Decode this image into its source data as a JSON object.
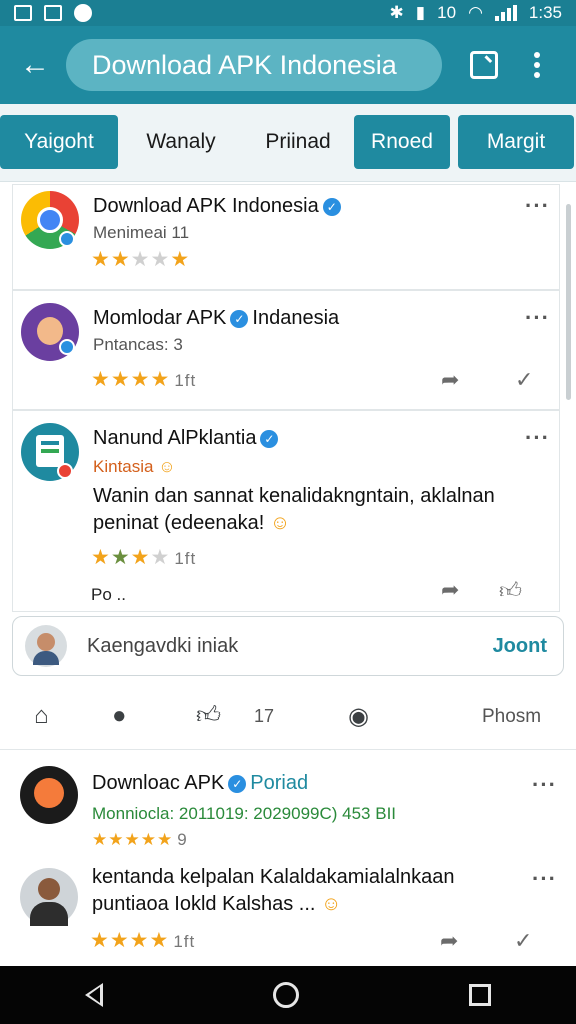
{
  "status": {
    "time": "1:35",
    "battery": "10"
  },
  "header": {
    "title": "Download APK Indonesia"
  },
  "tabs": [
    {
      "label": "Yaigoht",
      "filled": true
    },
    {
      "label": "Wanaly",
      "filled": false
    },
    {
      "label": "Priinad",
      "filled": false
    },
    {
      "label": "Rnoed",
      "filled": true
    },
    {
      "label": "Margit",
      "filled": true
    }
  ],
  "posts": [
    {
      "name": "Download APK Indonesia",
      "subtitle": "Menimeai 11",
      "stars": 5
    },
    {
      "name_a": "Momlodar APK",
      "name_b": "Indanesia",
      "subtitle": "Pntancas: 3",
      "rating_count": "1ft"
    },
    {
      "name": "Nanund AlPklantia",
      "subtitle": "Kintasia",
      "body_line1": "Wanin dan sannat kenalidakngntain, aklalnan",
      "body_line2": "peninat (edeenaka!",
      "rating_count": "1ft",
      "more_text": "Po .."
    }
  ],
  "comment": {
    "placeholder": "Kaengavdki iniak",
    "join": "Joont"
  },
  "toolbar": {
    "count": "17",
    "label": "Phosm"
  },
  "feed": [
    {
      "name_a": "Downloac APK",
      "name_b": "Poriad",
      "meta": "Monniocla: 2011019: 2029099C) 453 BII",
      "count": "9"
    },
    {
      "body_line1": "kentanda kelpalan Kalaldakamialalnkaan",
      "body_line2": "puntiaoa Iokld Kalshas ...",
      "rating_count": "1ft"
    }
  ],
  "colors": {
    "primary": "#1f8aa0",
    "star": "#f2a31b"
  }
}
